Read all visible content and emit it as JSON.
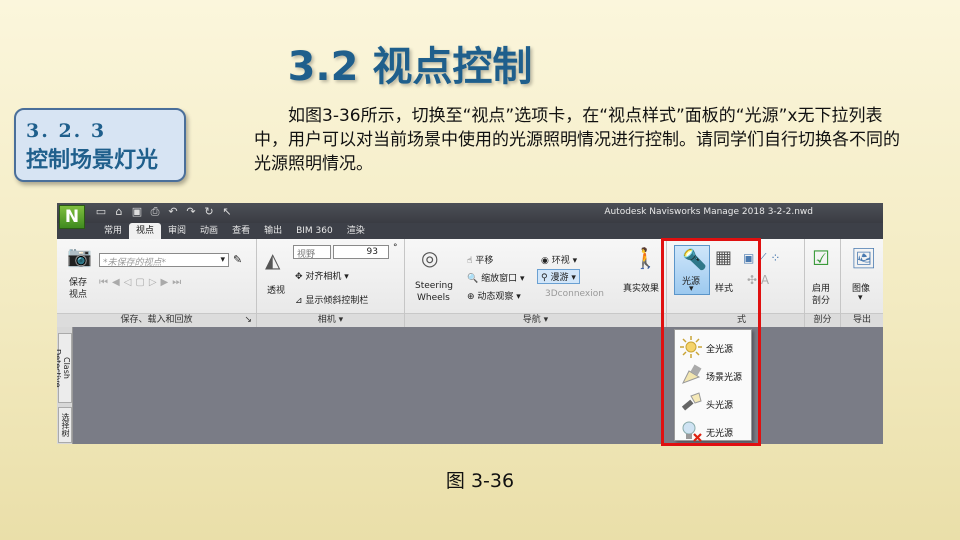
{
  "slide": {
    "title": "3.2 视点控制",
    "section_number": "3. 2. 3",
    "section_title": "控制场景灯光",
    "paragraph": "如图3-36所示，切换至“视点”选项卡，在“视点样式”面板的“光源”x无下拉列表中，用户可以对当前场景中使用的光源照明情况进行控制。请同学们自行切换各不同的光源照明情况。",
    "caption": "图 3-36"
  },
  "app": {
    "logo": "N",
    "window_title": "Autodesk Navisworks Manage 2018    3-2-2.nwd",
    "tabs": [
      "常用",
      "视点",
      "审阅",
      "动画",
      "查看",
      "输出",
      "BIM 360",
      "渲染"
    ],
    "active_tab": "视点",
    "ribbon": {
      "save": {
        "save_viewpoint": "保存",
        "save_viewpoint2": "视点",
        "viewpoint_placeholder": "*未保存的视点*",
        "panel_label": "保存、载入和回放"
      },
      "camera": {
        "perspective": "透视",
        "fov_label": "视野",
        "fov_value": "93",
        "fov_unit": "°",
        "align_camera": "对齐相机",
        "show_tilt": "显示倾斜控制栏",
        "panel_label": "相机"
      },
      "navigation": {
        "steering1": "Steering",
        "steering2": "Wheels",
        "pan": "平移",
        "zoom_window": "缩放窗口",
        "orbit": "动态观察",
        "look_around": "环视",
        "walk": "漫游",
        "connexion": "3Dconnexion",
        "realism": "真实效果",
        "panel_label": "导航"
      },
      "render_style": {
        "lighting": "光源",
        "mode": "样式",
        "panel_label_partial": "式"
      },
      "sectioning": {
        "enable": "启用",
        "enable2": "剖分",
        "panel_label": "剖分"
      },
      "export": {
        "image": "图像",
        "panel_label": "导出"
      }
    },
    "side_tabs": [
      "Clash Detective",
      "选择树"
    ],
    "lighting_menu": [
      "全光源",
      "场景光源",
      "头光源",
      "无光源"
    ]
  }
}
